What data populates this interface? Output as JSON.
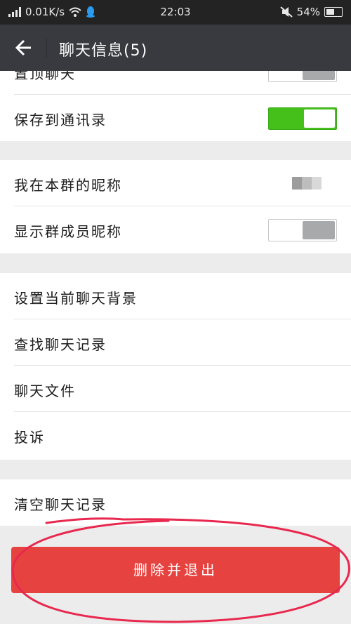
{
  "status_bar": {
    "speed": "0.01K/s",
    "time": "22:03",
    "battery": "54%",
    "icons": [
      "signal-icon",
      "wifi-icon",
      "qq-icon",
      "mute-icon",
      "battery-icon"
    ]
  },
  "header": {
    "title": "聊天信息(5)",
    "back_icon": "back-arrow-icon"
  },
  "section1": {
    "partial_label": "置顶聊天",
    "save_contacts_label": "保存到通讯录",
    "save_contacts_on": true
  },
  "section2": {
    "nickname_label": "我在本群的昵称",
    "show_nickname_label": "显示群成员昵称",
    "show_nickname_on": false
  },
  "section3": {
    "items": [
      "设置当前聊天背景",
      "查找聊天记录",
      "聊天文件",
      "投诉"
    ]
  },
  "section4": {
    "clear_label": "清空聊天记录"
  },
  "delete_button": "删除并退出",
  "colors": {
    "header_bg": "#393a3f",
    "toggle_on": "#45c01a",
    "delete_red": "#e64340",
    "annotation_red": "#e8284e"
  }
}
